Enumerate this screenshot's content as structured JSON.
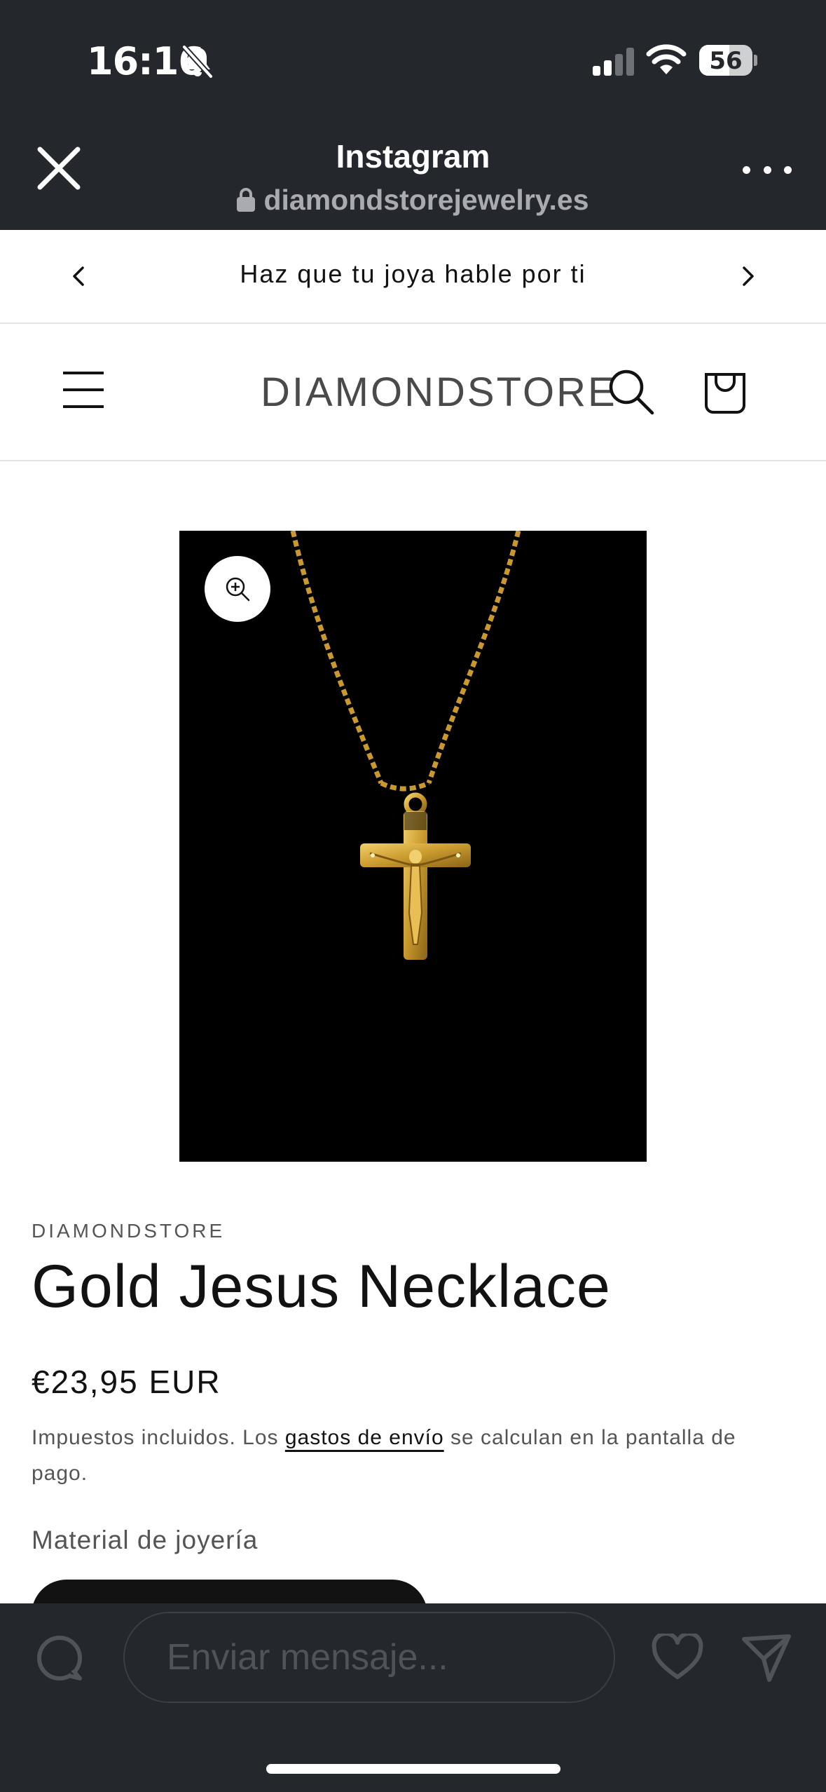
{
  "status_bar": {
    "time": "16:16",
    "battery_level": "56",
    "battery_fraction": 0.56,
    "icons": [
      "bell-slash-icon",
      "signal-icon",
      "wifi-icon",
      "battery-icon"
    ]
  },
  "browser": {
    "title": "Instagram",
    "url": "diamondstorejewelry.es",
    "icons": [
      "close-icon",
      "lock-icon",
      "more-icon"
    ]
  },
  "announcement": {
    "text": "Haz que tu joya hable por ti",
    "icons": [
      "chevron-left-icon",
      "chevron-right-icon"
    ]
  },
  "header": {
    "logo": "DIAMONDSTORE",
    "icons": [
      "menu-icon",
      "search-icon",
      "cart-icon"
    ]
  },
  "product": {
    "vendor": "DIAMONDSTORE",
    "title": "Gold Jesus Necklace",
    "price": "€23,95 EUR",
    "tax_note_before": "Impuestos incluidos. Los ",
    "tax_note_link": "gastos de envío",
    "tax_note_after": " se calculan en la pantalla de pago.",
    "material_label": "Material de joyería",
    "image_icon": "zoom-in-icon"
  },
  "bottom_bar": {
    "message_placeholder": "Enviar mensaje...",
    "icons": [
      "camera-icon",
      "heart-icon",
      "send-icon"
    ]
  },
  "colors": {
    "chrome_dark": "#24272c",
    "text": "#121212",
    "muted_text": "#555555",
    "gold": "#d4a437"
  }
}
